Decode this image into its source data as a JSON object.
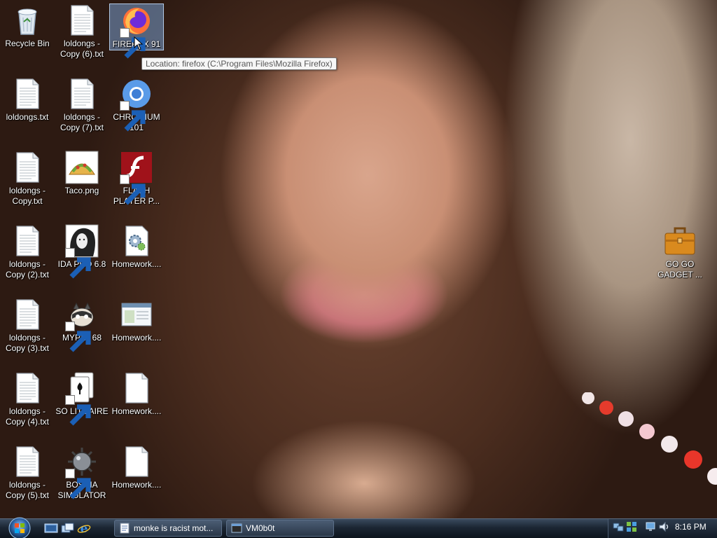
{
  "desktop": {
    "icons": [
      {
        "label": "Recycle Bin",
        "icon": "recycle-bin-icon"
      },
      {
        "label": "loldongs -\nCopy (6).txt",
        "icon": "text-file-icon"
      },
      {
        "label": "FIREFOX 91",
        "icon": "firefox-icon"
      },
      {
        "label": "loldongs.txt",
        "icon": "text-file-icon"
      },
      {
        "label": "loldongs -\nCopy (7).txt",
        "icon": "text-file-icon"
      },
      {
        "label": "CHROMIUM\n101",
        "icon": "chromium-icon"
      },
      {
        "label": "loldongs -\nCopy.txt",
        "icon": "text-file-icon"
      },
      {
        "label": "Taco.png",
        "icon": "taco-image-icon"
      },
      {
        "label": "FLASH\nPLAYER P...",
        "icon": "flash-player-icon"
      },
      {
        "label": "loldongs -\nCopy (2).txt",
        "icon": "text-file-icon"
      },
      {
        "label": "IDA PRO 6.8",
        "icon": "ida-pro-icon"
      },
      {
        "label": "Homework....",
        "icon": "settings-file-icon"
      },
      {
        "label": "loldongs -\nCopy (3).txt",
        "icon": "text-file-icon"
      },
      {
        "label": "MYPAL 68",
        "icon": "mypal-icon"
      },
      {
        "label": "Homework....",
        "icon": "window-file-icon"
      },
      {
        "label": "loldongs -\nCopy (4).txt",
        "icon": "text-file-icon"
      },
      {
        "label": "SO LIT!! AIRE",
        "icon": "solitaire-icon"
      },
      {
        "label": "Homework....",
        "icon": "blank-file-icon"
      },
      {
        "label": "loldongs -\nCopy (5).txt",
        "icon": "text-file-icon"
      },
      {
        "label": "BOSNIA\nSIMULATOR",
        "icon": "mine-icon"
      },
      {
        "label": "Homework....",
        "icon": "blank-file-icon"
      },
      {
        "label": "GO GO\nGADGET ...",
        "icon": "briefcase-icon"
      }
    ],
    "tooltip": "Location: firefox (C:\\Program Files\\Mozilla Firefox)"
  },
  "taskbar": {
    "start_icon": "windows-orb-icon",
    "quick_launch": [
      "show-desktop-icon",
      "switch-windows-icon",
      "internet-explorer-icon"
    ],
    "buttons": [
      {
        "label": "monke is racist mot...",
        "icon": "notepad-icon"
      },
      {
        "label": "VM0b0t",
        "icon": "terminal-icon"
      }
    ],
    "tray_icons": [
      "network-icon",
      "volume-icon",
      "display-icon",
      "speaker-icon"
    ],
    "clock": "8:16 PM"
  },
  "colors": {
    "taskbar": "#1b2633",
    "selection": "#78a0d2",
    "tooltip_bg": "#f6f6f6"
  }
}
